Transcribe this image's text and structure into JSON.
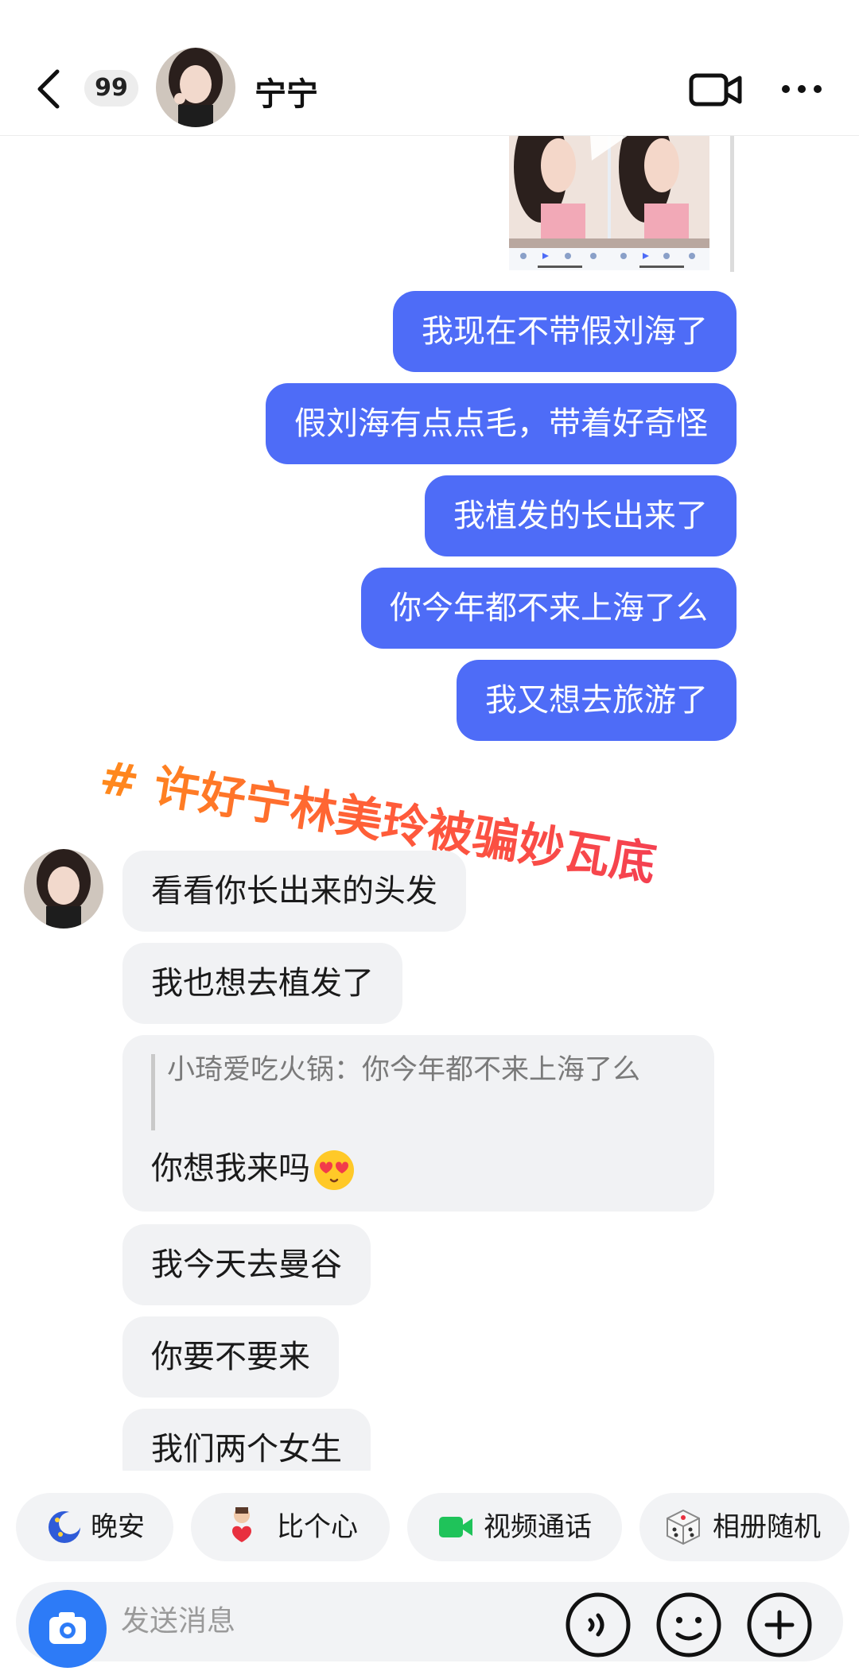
{
  "header": {
    "unread_count": "99",
    "contact_name": "宁宁"
  },
  "messages_out": [
    "我现在不带假刘海了",
    "假刘海有点点毛，带着好奇怪",
    "我植发的长出来了",
    "你今年都不来上海了么",
    "我又想去旅游了"
  ],
  "watermark": "# 许好宁林美玲被骗妙瓦底",
  "messages_in": [
    "看看你长出来的头发",
    "我也想去植发了",
    "我今天去曼谷",
    "你要不要来",
    "我们两个女生"
  ],
  "quote": {
    "quoted_text": "小琦爱吃火锅：你今年都不来上海了么",
    "reply_text": "你想我来吗"
  },
  "quick_replies": [
    {
      "label": "晚安",
      "icon": "moon-night-icon"
    },
    {
      "label": "比个心",
      "icon": "heart-gesture-icon"
    },
    {
      "label": "视频通话",
      "icon": "video-camera-icon"
    },
    {
      "label": "相册随机",
      "icon": "dice-icon"
    }
  ],
  "composer": {
    "placeholder": "发送消息"
  },
  "colors": {
    "outgoing_bubble": "#4e6cf7",
    "incoming_bubble": "#f1f2f4",
    "accent_blue": "#2d7bf7",
    "video_green": "#1fc35a"
  }
}
